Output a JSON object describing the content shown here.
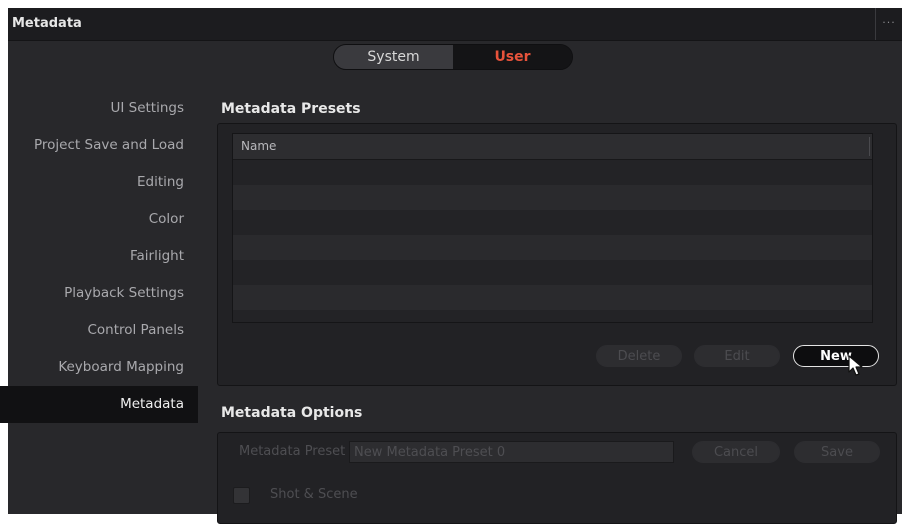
{
  "window": {
    "title": "Metadata",
    "menu_dots": "···"
  },
  "segmented": {
    "system_label": "System",
    "user_label": "User",
    "selected": "User"
  },
  "sidebar": {
    "items": [
      {
        "label": "UI Settings"
      },
      {
        "label": "Project Save and Load"
      },
      {
        "label": "Editing"
      },
      {
        "label": "Color"
      },
      {
        "label": "Fairlight"
      },
      {
        "label": "Playback Settings"
      },
      {
        "label": "Control Panels"
      },
      {
        "label": "Keyboard Mapping"
      },
      {
        "label": "Metadata"
      }
    ],
    "active": "Metadata"
  },
  "presets": {
    "section_title": "Metadata Presets",
    "table": {
      "columns": [
        "Name"
      ],
      "rows": []
    },
    "buttons": {
      "delete": "Delete",
      "edit": "Edit",
      "new": "New"
    }
  },
  "options": {
    "section_title": "Metadata Options",
    "preset_label": "Metadata Preset",
    "preset_value": "New Metadata Preset 0",
    "cancel": "Cancel",
    "save": "Save",
    "checkbox_label": "Shot & Scene",
    "checkbox_checked": false
  },
  "colors": {
    "accent": "#e8533b",
    "panel_bg": "#28282b"
  }
}
